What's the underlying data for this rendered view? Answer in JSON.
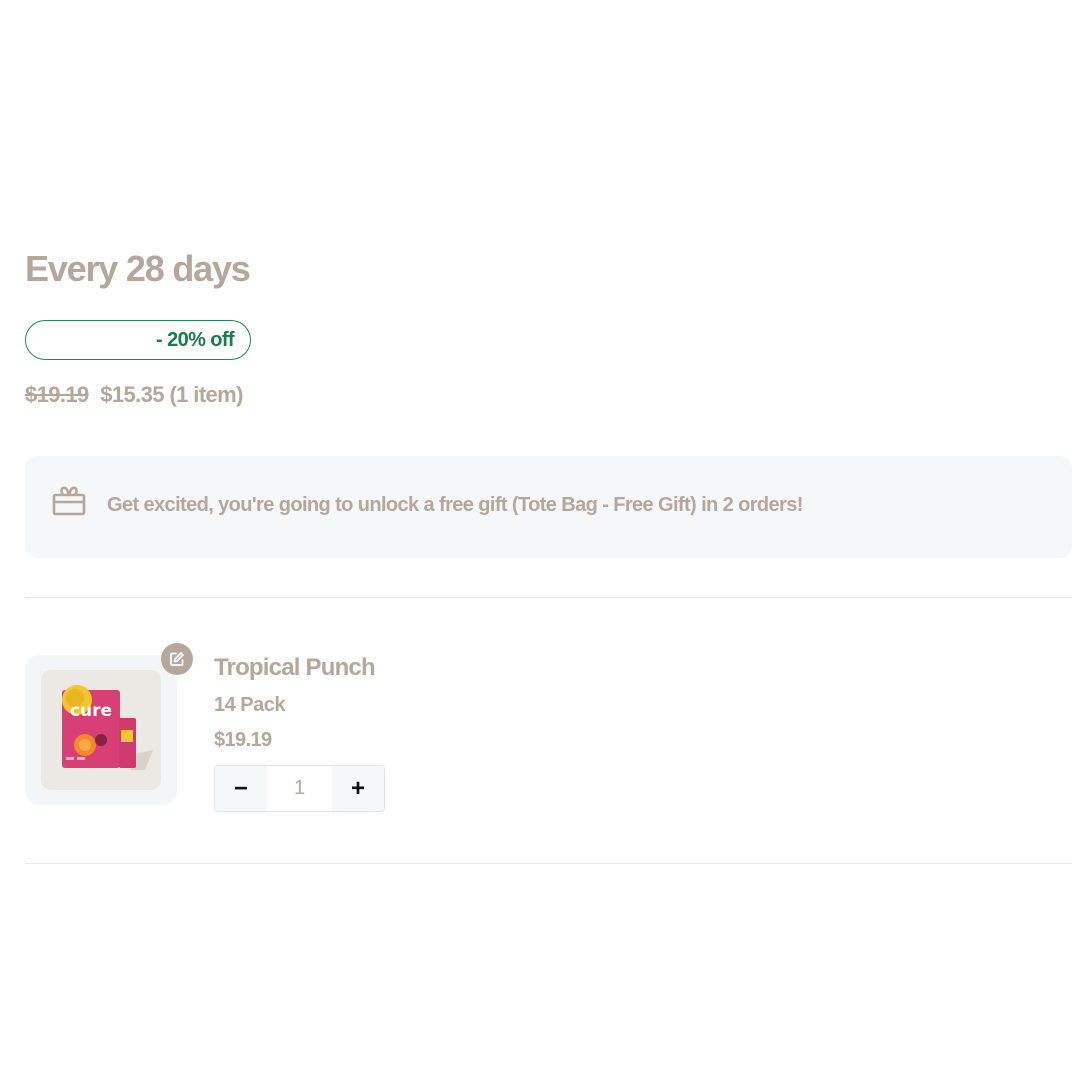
{
  "subscription": {
    "frequency_label": "Every 28 days",
    "discount_label": "- 20% off",
    "original_price": "$19.19",
    "discounted_price": "$15.35",
    "item_count_label": "(1 item)"
  },
  "gift_banner": {
    "icon": "gift-icon",
    "message": "Get excited, you're going to unlock a free gift (Tote Bag - Free Gift) in 2 orders!"
  },
  "line_item": {
    "image_alt_brand": "cure",
    "name": "Tropical Punch",
    "variant": "14 Pack",
    "price": "$19.19",
    "quantity": "1",
    "decrement_label": "−",
    "increment_label": "+",
    "edit_icon": "edit-icon"
  },
  "colors": {
    "muted_text": "#b5a79c",
    "discount_green": "#1d7a4c",
    "banner_bg": "#f6f7f9"
  }
}
